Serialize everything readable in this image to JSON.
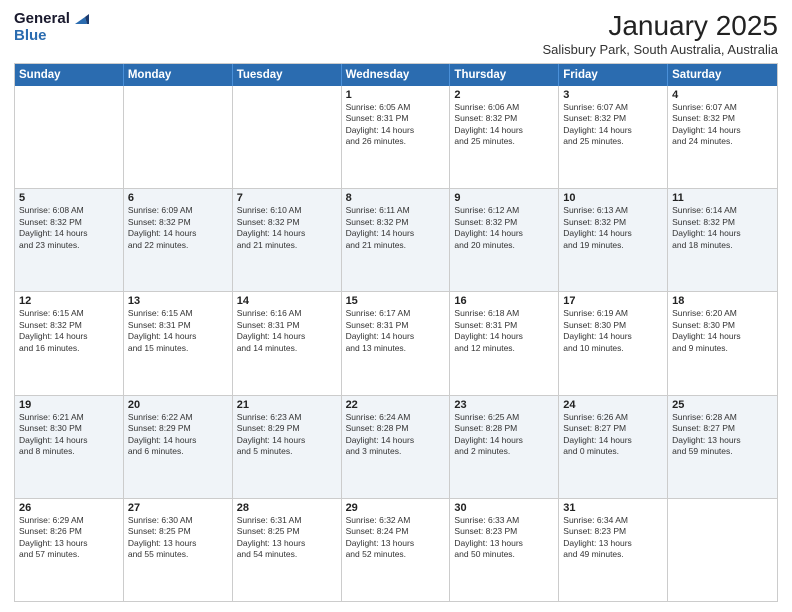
{
  "logo": {
    "line1": "General",
    "line2": "Blue"
  },
  "title": "January 2025",
  "subtitle": "Salisbury Park, South Australia, Australia",
  "header_days": [
    "Sunday",
    "Monday",
    "Tuesday",
    "Wednesday",
    "Thursday",
    "Friday",
    "Saturday"
  ],
  "weeks": [
    [
      {
        "day": "",
        "info": ""
      },
      {
        "day": "",
        "info": ""
      },
      {
        "day": "",
        "info": ""
      },
      {
        "day": "1",
        "info": "Sunrise: 6:05 AM\nSunset: 8:31 PM\nDaylight: 14 hours\nand 26 minutes."
      },
      {
        "day": "2",
        "info": "Sunrise: 6:06 AM\nSunset: 8:32 PM\nDaylight: 14 hours\nand 25 minutes."
      },
      {
        "day": "3",
        "info": "Sunrise: 6:07 AM\nSunset: 8:32 PM\nDaylight: 14 hours\nand 25 minutes."
      },
      {
        "day": "4",
        "info": "Sunrise: 6:07 AM\nSunset: 8:32 PM\nDaylight: 14 hours\nand 24 minutes."
      }
    ],
    [
      {
        "day": "5",
        "info": "Sunrise: 6:08 AM\nSunset: 8:32 PM\nDaylight: 14 hours\nand 23 minutes."
      },
      {
        "day": "6",
        "info": "Sunrise: 6:09 AM\nSunset: 8:32 PM\nDaylight: 14 hours\nand 22 minutes."
      },
      {
        "day": "7",
        "info": "Sunrise: 6:10 AM\nSunset: 8:32 PM\nDaylight: 14 hours\nand 21 minutes."
      },
      {
        "day": "8",
        "info": "Sunrise: 6:11 AM\nSunset: 8:32 PM\nDaylight: 14 hours\nand 21 minutes."
      },
      {
        "day": "9",
        "info": "Sunrise: 6:12 AM\nSunset: 8:32 PM\nDaylight: 14 hours\nand 20 minutes."
      },
      {
        "day": "10",
        "info": "Sunrise: 6:13 AM\nSunset: 8:32 PM\nDaylight: 14 hours\nand 19 minutes."
      },
      {
        "day": "11",
        "info": "Sunrise: 6:14 AM\nSunset: 8:32 PM\nDaylight: 14 hours\nand 18 minutes."
      }
    ],
    [
      {
        "day": "12",
        "info": "Sunrise: 6:15 AM\nSunset: 8:32 PM\nDaylight: 14 hours\nand 16 minutes."
      },
      {
        "day": "13",
        "info": "Sunrise: 6:15 AM\nSunset: 8:31 PM\nDaylight: 14 hours\nand 15 minutes."
      },
      {
        "day": "14",
        "info": "Sunrise: 6:16 AM\nSunset: 8:31 PM\nDaylight: 14 hours\nand 14 minutes."
      },
      {
        "day": "15",
        "info": "Sunrise: 6:17 AM\nSunset: 8:31 PM\nDaylight: 14 hours\nand 13 minutes."
      },
      {
        "day": "16",
        "info": "Sunrise: 6:18 AM\nSunset: 8:31 PM\nDaylight: 14 hours\nand 12 minutes."
      },
      {
        "day": "17",
        "info": "Sunrise: 6:19 AM\nSunset: 8:30 PM\nDaylight: 14 hours\nand 10 minutes."
      },
      {
        "day": "18",
        "info": "Sunrise: 6:20 AM\nSunset: 8:30 PM\nDaylight: 14 hours\nand 9 minutes."
      }
    ],
    [
      {
        "day": "19",
        "info": "Sunrise: 6:21 AM\nSunset: 8:30 PM\nDaylight: 14 hours\nand 8 minutes."
      },
      {
        "day": "20",
        "info": "Sunrise: 6:22 AM\nSunset: 8:29 PM\nDaylight: 14 hours\nand 6 minutes."
      },
      {
        "day": "21",
        "info": "Sunrise: 6:23 AM\nSunset: 8:29 PM\nDaylight: 14 hours\nand 5 minutes."
      },
      {
        "day": "22",
        "info": "Sunrise: 6:24 AM\nSunset: 8:28 PM\nDaylight: 14 hours\nand 3 minutes."
      },
      {
        "day": "23",
        "info": "Sunrise: 6:25 AM\nSunset: 8:28 PM\nDaylight: 14 hours\nand 2 minutes."
      },
      {
        "day": "24",
        "info": "Sunrise: 6:26 AM\nSunset: 8:27 PM\nDaylight: 14 hours\nand 0 minutes."
      },
      {
        "day": "25",
        "info": "Sunrise: 6:28 AM\nSunset: 8:27 PM\nDaylight: 13 hours\nand 59 minutes."
      }
    ],
    [
      {
        "day": "26",
        "info": "Sunrise: 6:29 AM\nSunset: 8:26 PM\nDaylight: 13 hours\nand 57 minutes."
      },
      {
        "day": "27",
        "info": "Sunrise: 6:30 AM\nSunset: 8:25 PM\nDaylight: 13 hours\nand 55 minutes."
      },
      {
        "day": "28",
        "info": "Sunrise: 6:31 AM\nSunset: 8:25 PM\nDaylight: 13 hours\nand 54 minutes."
      },
      {
        "day": "29",
        "info": "Sunrise: 6:32 AM\nSunset: 8:24 PM\nDaylight: 13 hours\nand 52 minutes."
      },
      {
        "day": "30",
        "info": "Sunrise: 6:33 AM\nSunset: 8:23 PM\nDaylight: 13 hours\nand 50 minutes."
      },
      {
        "day": "31",
        "info": "Sunrise: 6:34 AM\nSunset: 8:23 PM\nDaylight: 13 hours\nand 49 minutes."
      },
      {
        "day": "",
        "info": ""
      }
    ]
  ]
}
